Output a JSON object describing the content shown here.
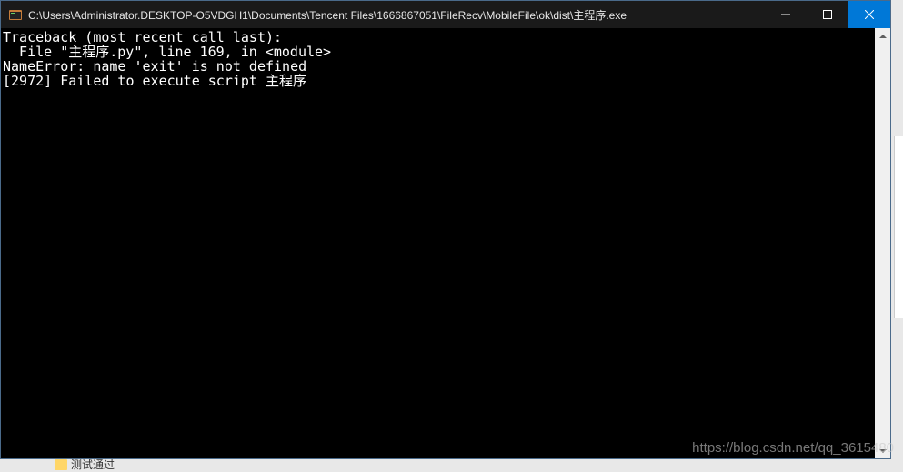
{
  "window": {
    "title": "C:\\Users\\Administrator.DESKTOP-O5VDGH1\\Documents\\Tencent Files\\1666867051\\FileRecv\\MobileFile\\ok\\dist\\主程序.exe"
  },
  "console": {
    "line1": "Traceback (most recent call last):",
    "line2": "  File \"主程序.py\", line 169, in <module>",
    "line3": "NameError: name 'exit' is not defined",
    "line4": "[2972] Failed to execute script 主程序"
  },
  "watermark": "https://blog.csdn.net/qq_3615480",
  "background": {
    "bottom_item": "测试通过"
  }
}
